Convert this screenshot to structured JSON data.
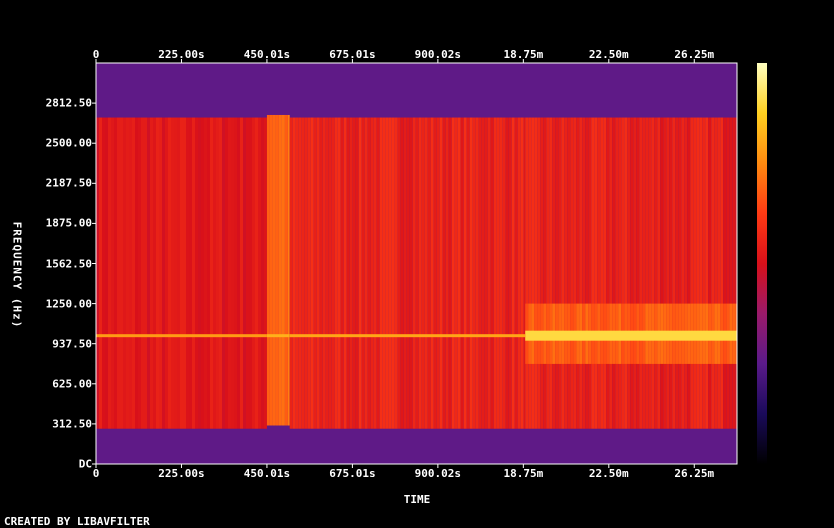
{
  "chart_data": {
    "type": "heatmap",
    "title": "",
    "xlabel": "TIME",
    "ylabel": "FREQUENCY (Hz)",
    "x_ticks_top": [
      "0",
      "225.00s",
      "450.01s",
      "675.01s",
      "900.02s",
      "18.75m",
      "22.50m",
      "26.25m"
    ],
    "x_ticks_bottom": [
      "0",
      "225.00s",
      "450.01s",
      "675.01s",
      "900.02s",
      "18.75m",
      "22.50m",
      "26.25m"
    ],
    "y_ticks": [
      "DC",
      "312.50",
      "625.00",
      "937.50",
      "1250.00",
      "1562.50",
      "1875.00",
      "2187.50",
      "2500.00",
      "2812.50"
    ],
    "y_tick_values": [
      0,
      312.5,
      625,
      937.5,
      1250,
      1562.5,
      1875,
      2187.5,
      2500,
      2812.5
    ],
    "x_tick_values_s": [
      0,
      225,
      450,
      675,
      900,
      1125,
      1350,
      1575
    ],
    "x_range_s": [
      0,
      1687.5
    ],
    "y_range_hz": [
      0,
      3125
    ],
    "colormap": [
      "#000000",
      "#1a0a5a",
      "#5a1a8a",
      "#9a1a6a",
      "#d8101a",
      "#ff3a14",
      "#ff8a10",
      "#ffd020",
      "#ffffc0"
    ],
    "segments": [
      {
        "start_s": 0,
        "end_s": 450,
        "band_hz": [
          275,
          2700
        ],
        "level": 0.52,
        "tone_hz": 1000,
        "tone_level": 0.78
      },
      {
        "start_s": 450,
        "end_s": 510,
        "band_hz": [
          300,
          2720
        ],
        "level": 0.7,
        "tone_hz": 1000,
        "tone_level": 0.82
      },
      {
        "start_s": 510,
        "end_s": 1130,
        "band_hz": [
          275,
          2700
        ],
        "level": 0.56,
        "tone_hz": 1000,
        "tone_level": 0.8
      },
      {
        "start_s": 1130,
        "end_s": 1687.5,
        "band_hz": [
          275,
          2700
        ],
        "level": 0.55,
        "tone_hz": 1000,
        "tone_level": 0.9,
        "bright_band_hz": [
          780,
          1250
        ],
        "bright_level": 0.68
      }
    ]
  },
  "footer_text": "CREATED BY LIBAVFILTER"
}
